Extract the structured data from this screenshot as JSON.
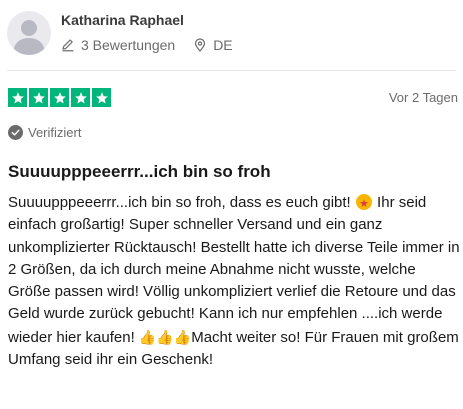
{
  "reviewer": {
    "name": "Katharina Raphael",
    "review_count_label": "3 Bewertungen",
    "country": "DE"
  },
  "rating": {
    "stars": 5,
    "max": 5,
    "color": "#00b67a"
  },
  "date_label": "Vor 2 Tagen",
  "verified_label": "Verifiziert",
  "review": {
    "title": "Suuuupppeeerrr...ich bin so froh",
    "body_part1": "Suuuupppeeerrr...ich bin so froh, dass es euch gibt! ",
    "body_part2": " Ihr seid einfach großartig! Super schneller Versand und ein ganz unkomplizierter Rücktausch! Bestellt hatte ich diverse Teile immer in 2 Größen, da ich durch meine Abnahme nicht wusste, welche Größe passen wird! Völlig unkompliziert verlief die Retoure und das Geld wurde zurück gebucht! Kann ich nur empfehlen ....ich werde wieder hier kaufen! ",
    "thumbs": "👍👍👍",
    "body_part3": "Macht weiter so! Für Frauen mit großem Umfang seid ihr ein Geschenk!"
  },
  "icons": {
    "avatar": "user-silhouette-icon",
    "reviews": "pencil-icon",
    "location": "location-pin-icon",
    "verified": "check-circle-icon",
    "emoji": "star-struck-emoji-icon"
  }
}
